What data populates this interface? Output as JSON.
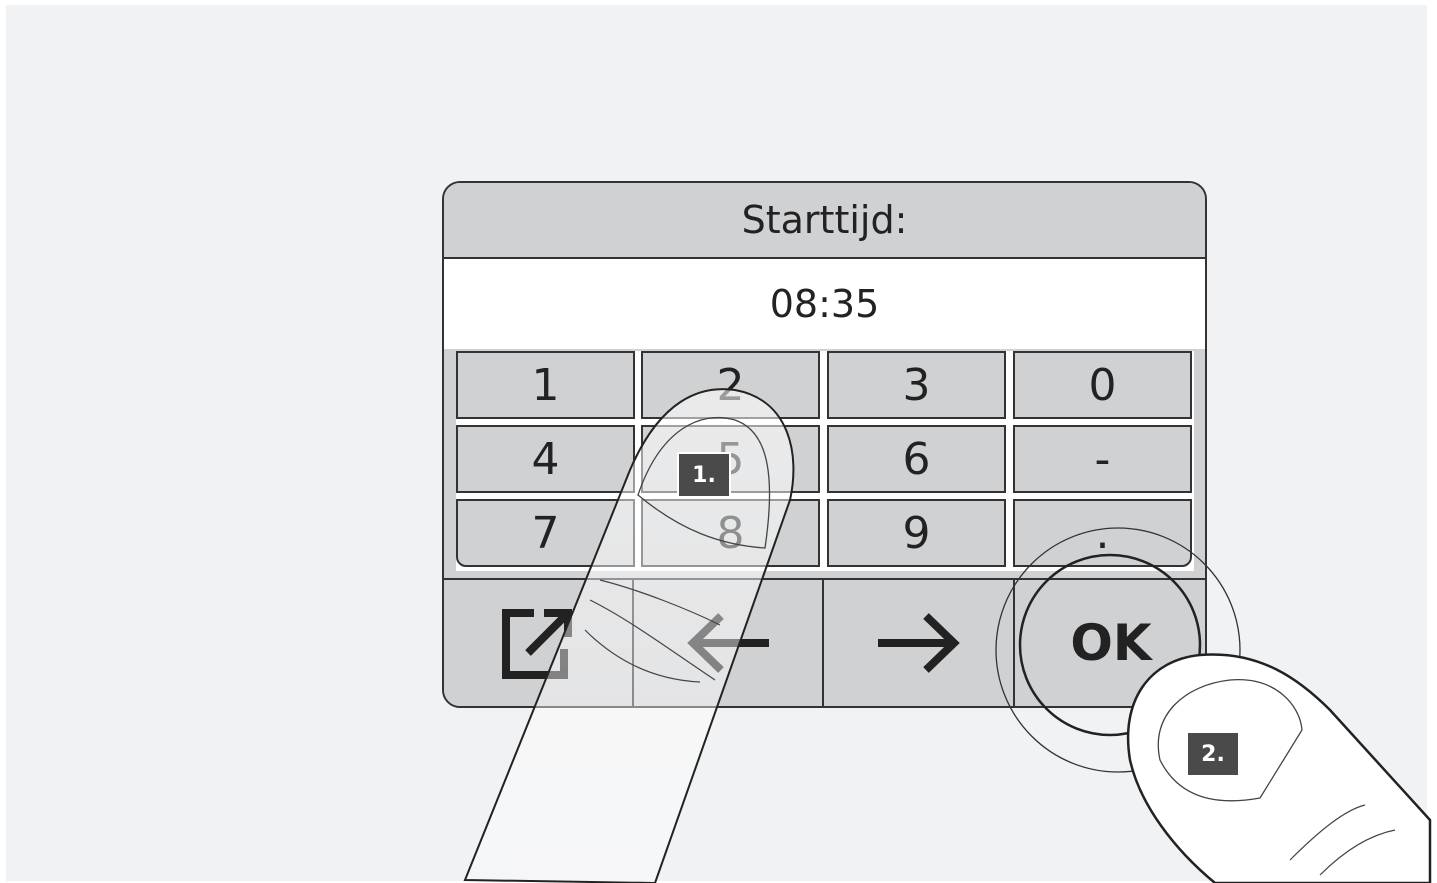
{
  "panel": {
    "title": "Starttijd:",
    "value": "08:35"
  },
  "keypad": {
    "keys": [
      "1",
      "2",
      "3",
      "0",
      "4",
      "5",
      "6",
      "-",
      "7",
      "8",
      "9",
      "."
    ]
  },
  "nav": {
    "ok_label": "OK",
    "icons": [
      "exit-icon",
      "back-arrow-icon",
      "forward-arrow-icon"
    ]
  },
  "steps": [
    "1.",
    "2."
  ],
  "colors": {
    "background": "#f1f2f4",
    "panel": "#d0d1d3",
    "outline": "#333333",
    "step_badge": "#4a4a4a"
  }
}
